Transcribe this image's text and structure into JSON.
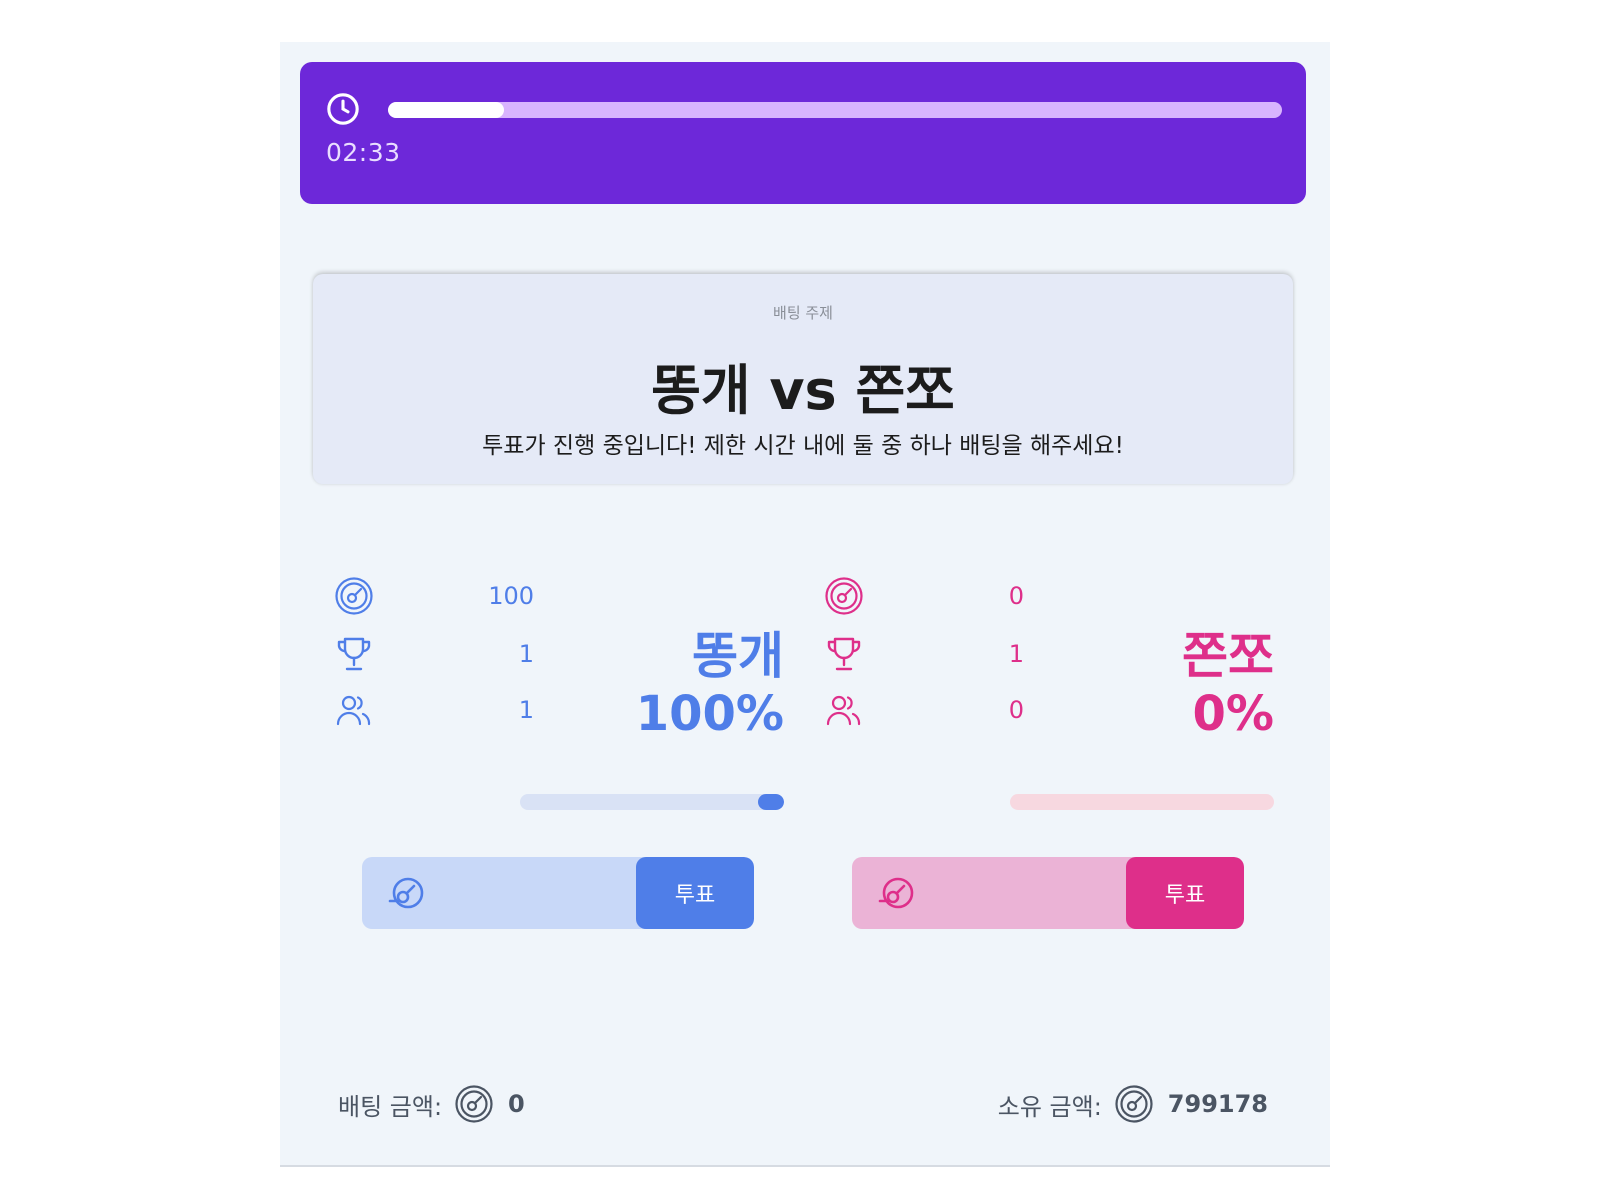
{
  "timer": {
    "remaining": "02:33",
    "progress": 0.13
  },
  "topic": {
    "label": "배팅 주제",
    "title": "똥개 vs 쫀쪼",
    "description": "투표가 진행 중입니다! 제한 시간 내에 둘 중 하나 배팅을 해주세요!"
  },
  "sides": [
    {
      "name": "똥개",
      "percent": "100%",
      "points": "100",
      "ratio": "1",
      "participants": "1",
      "bar_fill": 1.0,
      "color": "#4f7ee8",
      "bar_bg": "#d9e2f5",
      "vote_label": "투표"
    },
    {
      "name": "쫀쪼",
      "percent": "0%",
      "points": "0",
      "ratio": "1",
      "participants": "0",
      "bar_fill": 0.0,
      "color": "#de2f8a",
      "bar_bg": "#f7d8e0",
      "vote_label": "투표"
    }
  ],
  "footer": {
    "bet_label": "배팅 금액:",
    "bet_amount": "0",
    "owned_label": "소유 금액:",
    "owned_amount": "799178"
  },
  "icons": {
    "timer": "clock-icon",
    "points": "coin-icon",
    "ratio": "trophy-icon",
    "participants": "users-icon"
  }
}
